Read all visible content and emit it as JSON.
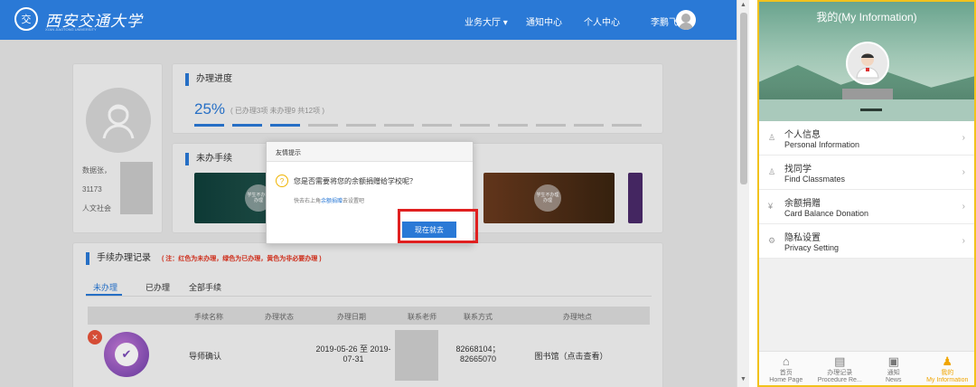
{
  "desktop": {
    "logo_seal": "交",
    "logo_name": "西安交通大学",
    "logo_sub": "XI'AN JIAOTONG UNIVERSITY",
    "nav": {
      "hall": "业务大厅 ▾",
      "notice": "通知中心",
      "center": "个人中心",
      "user": "李鹏飞"
    },
    "profile": {
      "line1": "数据张，",
      "line2": "31173",
      "line3": "人文社会"
    },
    "progress": {
      "title": "办理进度",
      "percent": "25%",
      "detail": "( 已办理3项  未办理9  共12项 )",
      "total_segments": 12,
      "done_segments": 3
    },
    "pending": {
      "title": "未办手续",
      "tile1_badge": "学生不办理\n办理",
      "tile2_badge": "学生不办理\n办理"
    },
    "records": {
      "title": "手续办理记录",
      "note": "( 注：红色为未办理，绿色为已办理，黄色为非必要办理 )",
      "tabs": [
        "未办理",
        "已办理",
        "全部手续"
      ],
      "headers": [
        "手续名称",
        "办理状态",
        "办理日期",
        "联系老师",
        "联系方式",
        "办理地点"
      ],
      "row": {
        "name": "导师确认",
        "status_icon": "✕",
        "date": "2019-05-26 至 2019-07-31",
        "phone": "82668104；82665070",
        "place": "图书馆（点击查看）"
      }
    },
    "dialog": {
      "title": "友情提示",
      "message": "您是否需要将您的余额捐赠给学校呢？",
      "hint_prefix": "快去右上角",
      "hint_link": "余额捐赠",
      "hint_suffix": "去设置吧",
      "button": "现在就去"
    }
  },
  "mobile": {
    "title": "我的(My Information)",
    "menu": [
      {
        "icon": "♙",
        "cn": "个人信息",
        "en": "Personal Information"
      },
      {
        "icon": "♙",
        "cn": "找同学",
        "en": "Find Classmates"
      },
      {
        "icon": "¥",
        "cn": "余额捐赠",
        "en": "Card Balance Donation"
      },
      {
        "icon": "⚙",
        "cn": "隐私设置",
        "en": "Privacy Setting"
      }
    ],
    "tabs": [
      {
        "icon": "⌂",
        "cn": "首页",
        "en": "Home Page"
      },
      {
        "icon": "▤",
        "cn": "办理记录",
        "en": "Procedure Re..."
      },
      {
        "icon": "▣",
        "cn": "通知",
        "en": "News"
      },
      {
        "icon": "♟",
        "cn": "我的",
        "en": "My Information"
      }
    ],
    "colors": {
      "accent": "#f0a500",
      "border": "#f2c21d"
    }
  }
}
